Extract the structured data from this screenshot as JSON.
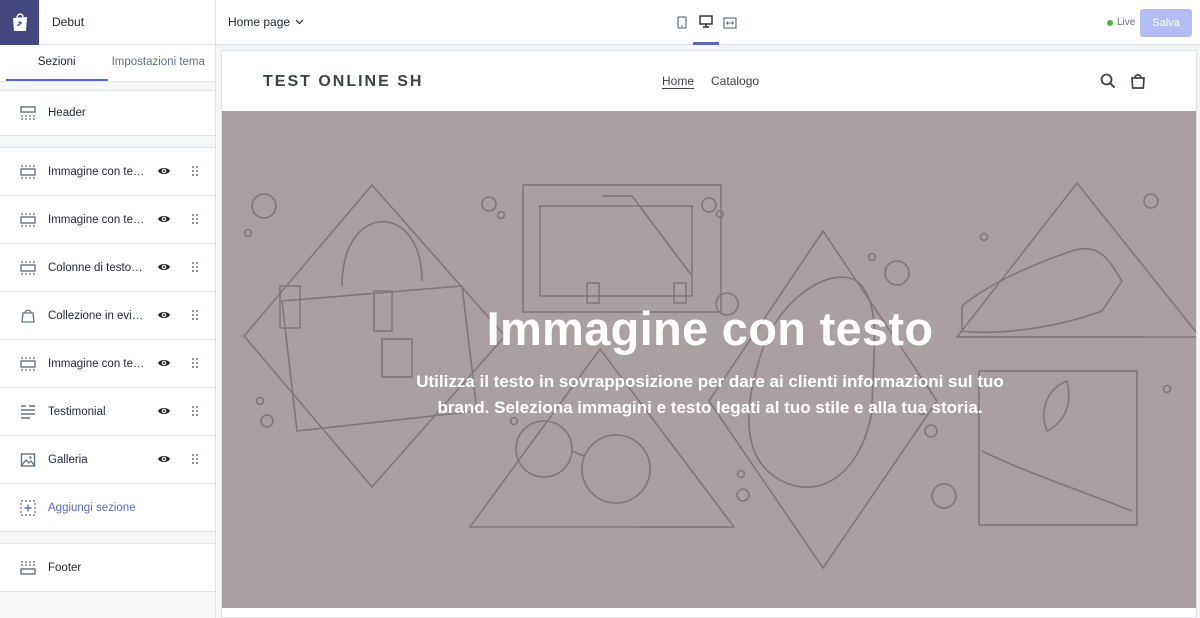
{
  "app": {
    "theme_name": "Debut",
    "logo_icon": "shopify-bag-icon"
  },
  "tabs": [
    {
      "label": "Sezioni",
      "active": true
    },
    {
      "label": "Impostazioni tema",
      "active": false
    }
  ],
  "sections": {
    "header": {
      "label": "Header",
      "icon": "header-layout-icon"
    },
    "items": [
      {
        "label": "Immagine con testo",
        "icon": "image-with-text-icon"
      },
      {
        "label": "Immagine con testo",
        "icon": "image-with-text-icon"
      },
      {
        "label": "Colonne di testo c...",
        "icon": "text-columns-icon"
      },
      {
        "label": "Collezione in evid...",
        "icon": "featured-collection-icon"
      },
      {
        "label": "Immagine con testo",
        "icon": "image-with-text-icon"
      },
      {
        "label": "Testimonial",
        "icon": "testimonial-icon"
      },
      {
        "label": "Galleria",
        "icon": "gallery-icon"
      }
    ],
    "add_label": "Aggiungi sezione",
    "footer": {
      "label": "Footer",
      "icon": "footer-layout-icon"
    }
  },
  "topbar": {
    "page_selector": "Home page",
    "devices": [
      "mobile-icon",
      "desktop-icon",
      "fullwidth-icon"
    ],
    "active_device": "desktop-icon",
    "status": "Live",
    "save_label": "Salva"
  },
  "store": {
    "logo_text": "TEST ONLINE SH",
    "nav": [
      "Home",
      "Catalogo"
    ],
    "active_nav": "Home",
    "icons": [
      "search-icon",
      "cart-icon"
    ],
    "hero_title": "Immagine con testo",
    "hero_text": "Utilizza il testo in sovrapposizione per dare ai clienti informazioni sul tuo brand. Seleziona immagini e testo legati al tuo stile e alla tua storia."
  },
  "colors": {
    "accent": "#5c6ac4",
    "logo_bg": "#43467f",
    "hero_bg": "#aba0a1",
    "save_disabled": "#b3bcf5",
    "live_dot": "#50b83c"
  }
}
